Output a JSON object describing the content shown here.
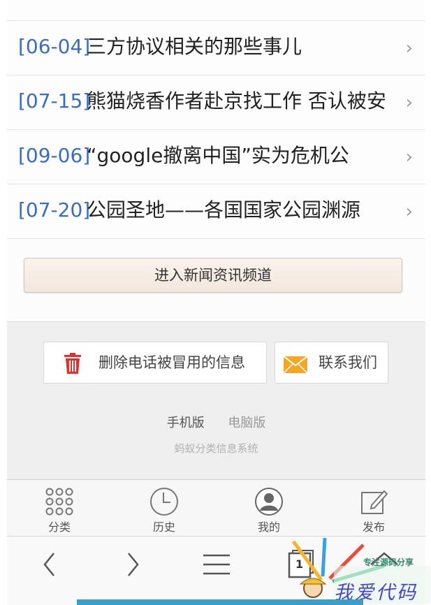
{
  "news": [
    {
      "date": "",
      "title": ""
    },
    {
      "date": "[06-04]",
      "title": "三方协议相关的那些事儿"
    },
    {
      "date": "[07-15]",
      "title": "熊猫烧香作者赴京找工作 否认被安"
    },
    {
      "date": "[09-06]",
      "title": "“google撤离中国”实为危机公"
    },
    {
      "date": "[07-20]",
      "title": "公园圣地——各国国家公园渊源"
    }
  ],
  "channel_button": "进入新闻资讯频道",
  "footer": {
    "delete_label": "删除电话被冒用的信息",
    "contact_label": "联系我们",
    "mobile_version": "手机版",
    "pc_version": "电脑版",
    "system_name": "蚂蚁分类信息系统"
  },
  "bottom_nav": {
    "category": "分类",
    "history": "历史",
    "mine": "我的",
    "publish": "发布"
  },
  "browser": {
    "tab_count": "1"
  },
  "watermark": {
    "slogan": "专注源码分享",
    "brand": "我爱代码"
  },
  "colors": {
    "date_blue": "#3a6cc0",
    "trash_red": "#e0322a",
    "mail_orange": "#f5a623"
  }
}
